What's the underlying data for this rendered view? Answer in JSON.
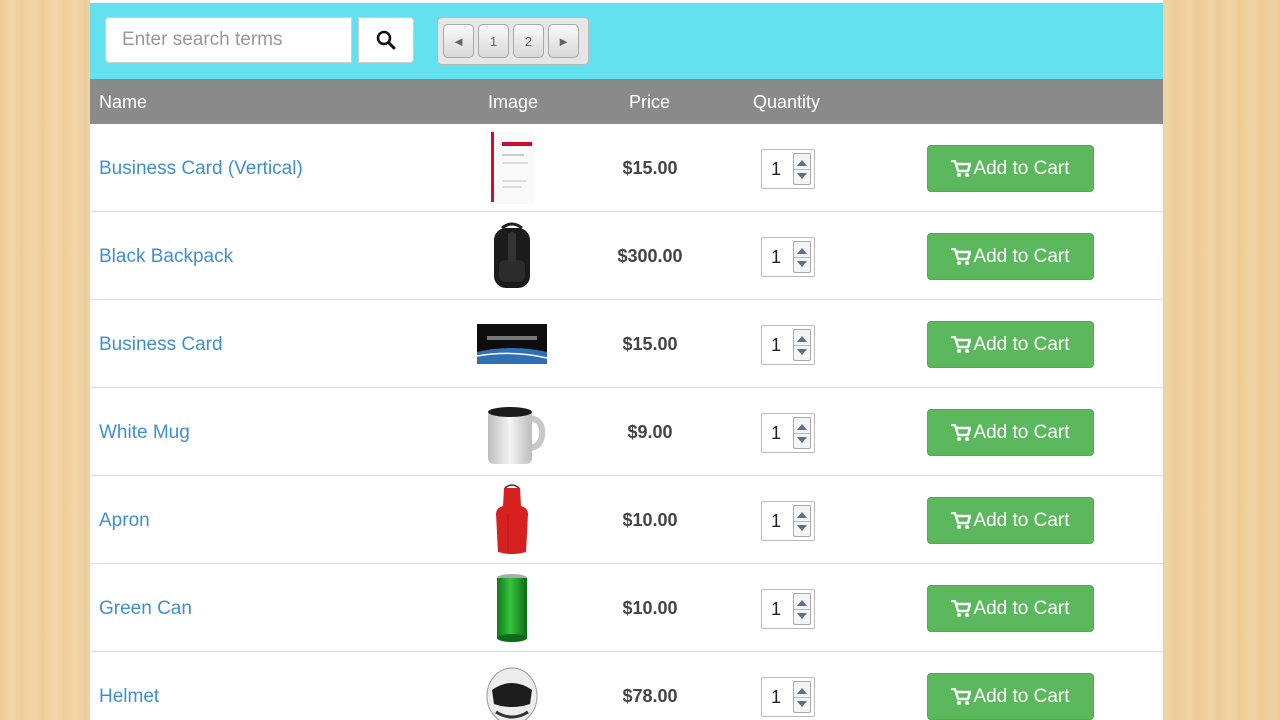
{
  "search": {
    "placeholder": "Enter search terms",
    "icon": "search-icon"
  },
  "pager": {
    "prev_icon": "◄",
    "pages": [
      "1",
      "2"
    ],
    "next_icon": "►"
  },
  "table": {
    "headers": {
      "name": "Name",
      "image": "Image",
      "price": "Price",
      "quantity": "Quantity"
    }
  },
  "products": [
    {
      "name": "Business Card (Vertical)",
      "image": "business-card-vertical-image",
      "price": "$15.00",
      "quantity": "1",
      "button": "Add to Cart"
    },
    {
      "name": "Black Backpack",
      "image": "backpack-image",
      "price": "$300.00",
      "quantity": "1",
      "button": "Add to Cart"
    },
    {
      "name": "Business Card",
      "image": "business-card-image",
      "price": "$15.00",
      "quantity": "1",
      "button": "Add to Cart"
    },
    {
      "name": "White Mug",
      "image": "mug-image",
      "price": "$9.00",
      "quantity": "1",
      "button": "Add to Cart"
    },
    {
      "name": "Apron",
      "image": "apron-image",
      "price": "$10.00",
      "quantity": "1",
      "button": "Add to Cart"
    },
    {
      "name": "Green Can",
      "image": "can-image",
      "price": "$10.00",
      "quantity": "1",
      "button": "Add to Cart"
    },
    {
      "name": "Helmet",
      "image": "helmet-image",
      "price": "$78.00",
      "quantity": "1",
      "button": "Add to Cart"
    }
  ],
  "colors": {
    "toolbar": "#64e1ef",
    "header": "#8a8a8a",
    "link": "#3f8fd2",
    "cart_button": "#5cb85c"
  }
}
